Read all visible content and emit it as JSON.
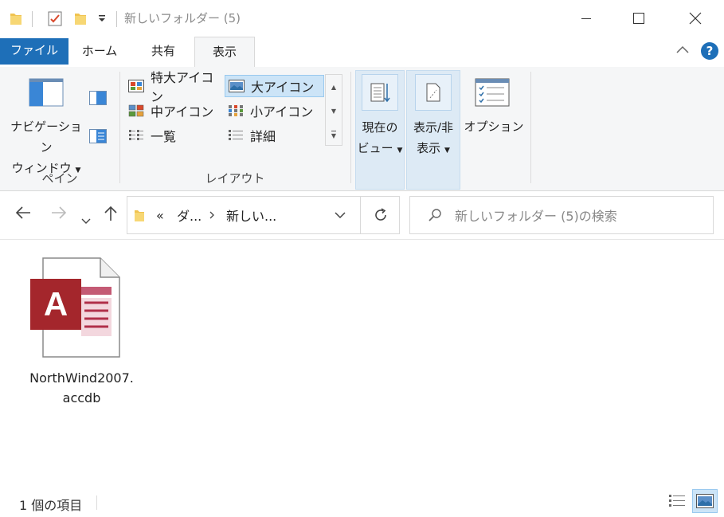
{
  "window": {
    "title": "新しいフォルダー (5)"
  },
  "tabs": [
    {
      "label": "ファイル"
    },
    {
      "label": "ホーム"
    },
    {
      "label": "共有"
    },
    {
      "label": "表示"
    }
  ],
  "ribbon": {
    "pane": {
      "nav_pane_line1": "ナビゲーション",
      "nav_pane_line2": "ウィンドウ",
      "group_label": "ペイン"
    },
    "layout": {
      "items": [
        {
          "label": "特大アイコン"
        },
        {
          "label": "大アイコン"
        },
        {
          "label": "中アイコン"
        },
        {
          "label": "小アイコン"
        },
        {
          "label": "一覧"
        },
        {
          "label": "詳細"
        }
      ],
      "selected": "大アイコン",
      "group_label": "レイアウト"
    },
    "current_view_line1": "現在の",
    "current_view_line2": "ビュー",
    "show_hide_line1": "表示/非",
    "show_hide_line2": "表示",
    "options": "オプション"
  },
  "address": {
    "path_overflow": "«",
    "segments": [
      "ダ...",
      "新しい..."
    ]
  },
  "search": {
    "placeholder": "新しいフォルダー (5)の検索"
  },
  "files": [
    {
      "name_line1": "NorthWind2007.",
      "name_line2": "accdb",
      "icon": "access-file-icon",
      "letter": "A"
    }
  ],
  "status": {
    "item_count": "1 個の項目"
  },
  "colors": {
    "accent": "#1e6fb8",
    "access_red": "#a4262c",
    "selection": "#cce4f7"
  }
}
